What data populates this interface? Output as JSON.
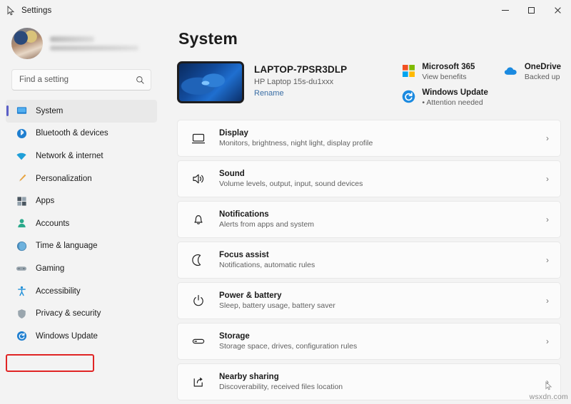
{
  "window": {
    "title": "Settings",
    "controls": {
      "minimize": "Minimize",
      "maximize": "Maximize",
      "close": "Close"
    }
  },
  "sidebar": {
    "profile": {
      "name_redacted": true,
      "email_redacted": true
    },
    "search": {
      "placeholder": "Find a setting",
      "value": "",
      "icon": "search-icon"
    },
    "items": [
      {
        "label": "System",
        "icon": "monitor-icon",
        "active": true,
        "highlighted": false
      },
      {
        "label": "Bluetooth & devices",
        "icon": "bluetooth-icon",
        "active": false,
        "highlighted": false
      },
      {
        "label": "Network & internet",
        "icon": "wifi-icon",
        "active": false,
        "highlighted": false
      },
      {
        "label": "Personalization",
        "icon": "paintbrush-icon",
        "active": false,
        "highlighted": false
      },
      {
        "label": "Apps",
        "icon": "apps-grid-icon",
        "active": false,
        "highlighted": false
      },
      {
        "label": "Accounts",
        "icon": "person-icon",
        "active": false,
        "highlighted": false
      },
      {
        "label": "Time & language",
        "icon": "globe-clock-icon",
        "active": false,
        "highlighted": false
      },
      {
        "label": "Gaming",
        "icon": "gamepad-icon",
        "active": false,
        "highlighted": false
      },
      {
        "label": "Accessibility",
        "icon": "accessibility-icon",
        "active": false,
        "highlighted": false
      },
      {
        "label": "Privacy & security",
        "icon": "shield-icon",
        "active": false,
        "highlighted": false
      },
      {
        "label": "Windows Update",
        "icon": "sync-icon",
        "active": false,
        "highlighted": true
      }
    ]
  },
  "main": {
    "page_title": "System",
    "device": {
      "name": "LAPTOP-7PSR3DLP",
      "model": "HP Laptop 15s-du1xxx",
      "rename_label": "Rename",
      "thumbnail": "windows-bloom-wallpaper"
    },
    "statuses": [
      {
        "title": "Microsoft 365",
        "sub": "View benefits",
        "icon": "microsoft-logo-icon",
        "bullet": false
      },
      {
        "title": "OneDrive",
        "sub": "Backed up",
        "icon": "onedrive-cloud-icon",
        "bullet": false
      },
      {
        "title": "Windows Update",
        "sub": "Attention needed",
        "icon": "sync-icon",
        "bullet": true
      }
    ],
    "rows": [
      {
        "title": "Display",
        "sub": "Monitors, brightness, night light, display profile",
        "icon": "monitor-icon",
        "chevron": "›"
      },
      {
        "title": "Sound",
        "sub": "Volume levels, output, input, sound devices",
        "icon": "speaker-icon",
        "chevron": "›"
      },
      {
        "title": "Notifications",
        "sub": "Alerts from apps and system",
        "icon": "bell-icon",
        "chevron": "›"
      },
      {
        "title": "Focus assist",
        "sub": "Notifications, automatic rules",
        "icon": "moon-icon",
        "chevron": "›"
      },
      {
        "title": "Power & battery",
        "sub": "Sleep, battery usage, battery saver",
        "icon": "power-icon",
        "chevron": "›"
      },
      {
        "title": "Storage",
        "sub": "Storage space, drives, configuration rules",
        "icon": "drive-icon",
        "chevron": "›"
      },
      {
        "title": "Nearby sharing",
        "sub": "Discoverability, received files location",
        "icon": "share-icon",
        "chevron": "›"
      }
    ]
  },
  "watermark": {
    "text": "wsxdn.com"
  },
  "colors": {
    "accent": "#0067c0",
    "selection_indicator": "#5b5fc7",
    "annotation": "#e02424",
    "page_bg": "#f3f3f3",
    "card_bg": "#fbfbfb",
    "link": "#3a6ea5"
  }
}
